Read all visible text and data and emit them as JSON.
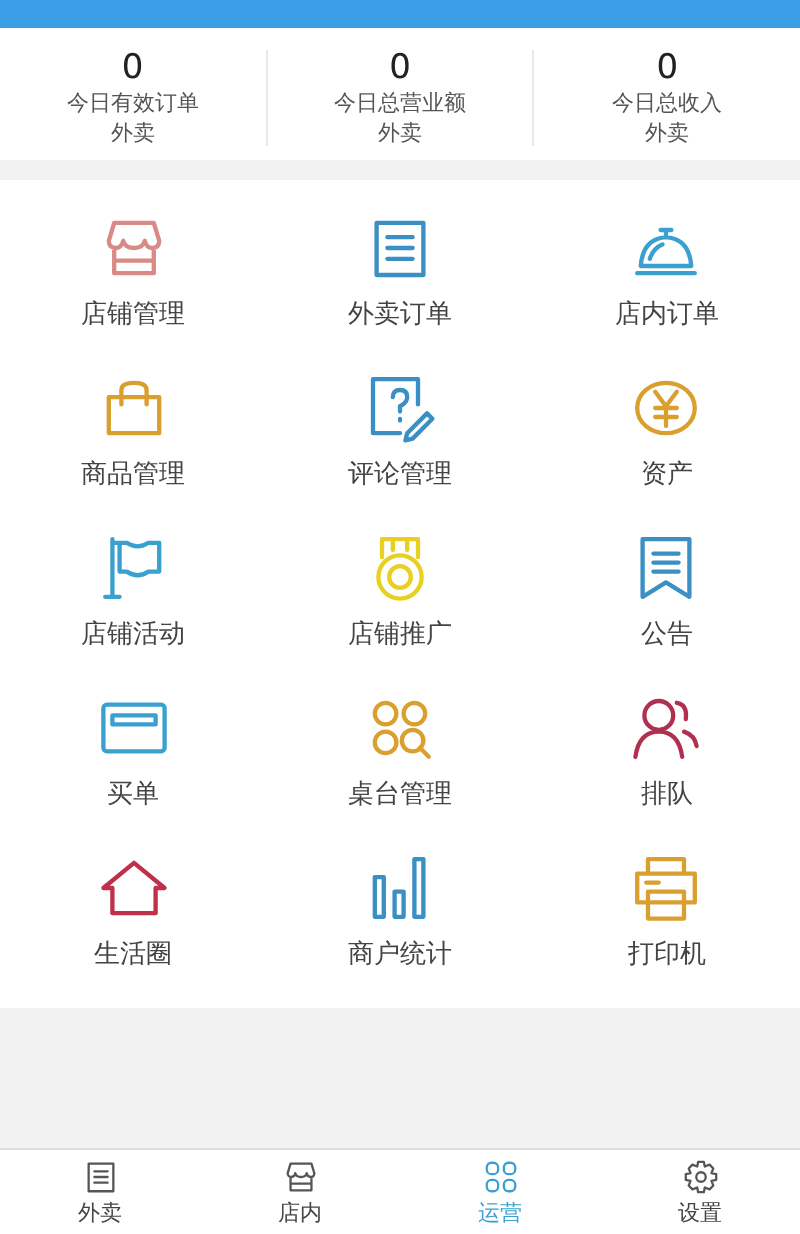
{
  "stats": [
    {
      "value": "0",
      "label": "今日有效订单",
      "sublabel": "外卖"
    },
    {
      "value": "0",
      "label": "今日总营业额",
      "sublabel": "外卖"
    },
    {
      "value": "0",
      "label": "今日总收入",
      "sublabel": "外卖"
    }
  ],
  "menu": [
    {
      "label": "店铺管理",
      "kind": "store"
    },
    {
      "label": "外卖订单",
      "kind": "list"
    },
    {
      "label": "店内订单",
      "kind": "cloche"
    },
    {
      "label": "商品管理",
      "kind": "bag"
    },
    {
      "label": "评论管理",
      "kind": "review"
    },
    {
      "label": "资产",
      "kind": "yen"
    },
    {
      "label": "店铺活动",
      "kind": "flag"
    },
    {
      "label": "店铺推广",
      "kind": "medal"
    },
    {
      "label": "公告",
      "kind": "notice"
    },
    {
      "label": "买单",
      "kind": "card"
    },
    {
      "label": "桌台管理",
      "kind": "tables"
    },
    {
      "label": "排队",
      "kind": "people"
    },
    {
      "label": "生活圈",
      "kind": "house"
    },
    {
      "label": "商户统计",
      "kind": "bars"
    },
    {
      "label": "打印机",
      "kind": "printer"
    }
  ],
  "tabs": [
    {
      "label": "外卖",
      "kind": "list",
      "selected": false
    },
    {
      "label": "店内",
      "kind": "store",
      "selected": false
    },
    {
      "label": "运营",
      "kind": "grid",
      "selected": true
    },
    {
      "label": "设置",
      "kind": "gear",
      "selected": false
    }
  ]
}
